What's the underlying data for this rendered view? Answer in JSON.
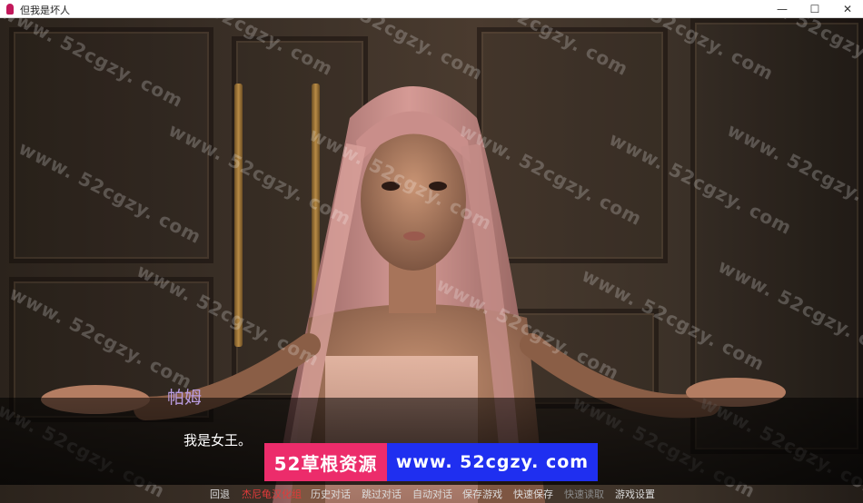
{
  "window": {
    "title": "但我是坏人",
    "minimize_glyph": "—",
    "maximize_glyph": "☐",
    "close_glyph": "✕"
  },
  "dialogue": {
    "speaker": "帕姆",
    "text": "我是女王。",
    "speaker_color": "#b99ce0"
  },
  "watermark": {
    "text": "www. 52cgzy. com"
  },
  "brand": {
    "left_text": "52草根资源",
    "right_text": "www. 52cgzy. com",
    "left_color": "#ec2c6b",
    "right_color": "#1f2ff0"
  },
  "quick_menu": {
    "items": [
      {
        "label": "回退",
        "state": "normal"
      },
      {
        "label": "杰尼龟汉化组",
        "state": "credit"
      },
      {
        "label": "历史对话",
        "state": "normal"
      },
      {
        "label": "跳过对话",
        "state": "normal"
      },
      {
        "label": "自动对话",
        "state": "normal"
      },
      {
        "label": "保存游戏",
        "state": "normal"
      },
      {
        "label": "快速保存",
        "state": "normal"
      },
      {
        "label": "快速读取",
        "state": "disabled"
      },
      {
        "label": "游戏设置",
        "state": "normal"
      }
    ]
  }
}
